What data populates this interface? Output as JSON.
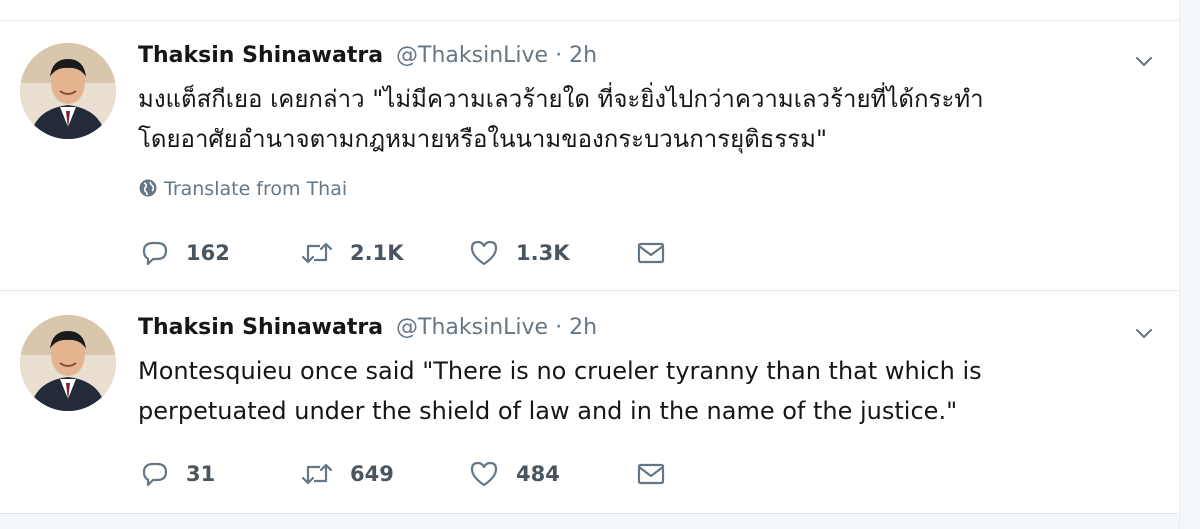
{
  "tweets": [
    {
      "name": "Thaksin Shinawatra",
      "handle": "@ThaksinLive",
      "separator": "·",
      "time": "2h",
      "text_lines": [
        "มงแต็สกีเยอ เคยกล่าว \"ไม่มีความเลวร้ายใด ที่จะยิ่งไปกว่าความเลวร้ายที่ได้กระทำ",
        "โดยอาศัยอำนาจตามกฎหมายหรือในนามของกระบวนการยุติธรรม\""
      ],
      "translate_label": "Translate from Thai",
      "replies": "162",
      "retweets": "2.1K",
      "likes": "1.3K"
    },
    {
      "name": "Thaksin Shinawatra",
      "handle": "@ThaksinLive",
      "separator": "·",
      "time": "2h",
      "text_lines": [
        "Montesquieu once said \"There is no crueler tyranny than that which is",
        "perpetuated under the shield of law and in the name of the justice.\""
      ],
      "replies": "31",
      "retweets": "649",
      "likes": "484"
    }
  ],
  "icons": {
    "reply": "reply-icon",
    "retweet": "retweet-icon",
    "like": "heart-icon",
    "dm": "envelope-icon",
    "caret": "chevron-down-icon",
    "translate": "globe-icon"
  },
  "colors": {
    "text": "#14171a",
    "secondary": "#657786",
    "border": "#e1e8ed"
  }
}
